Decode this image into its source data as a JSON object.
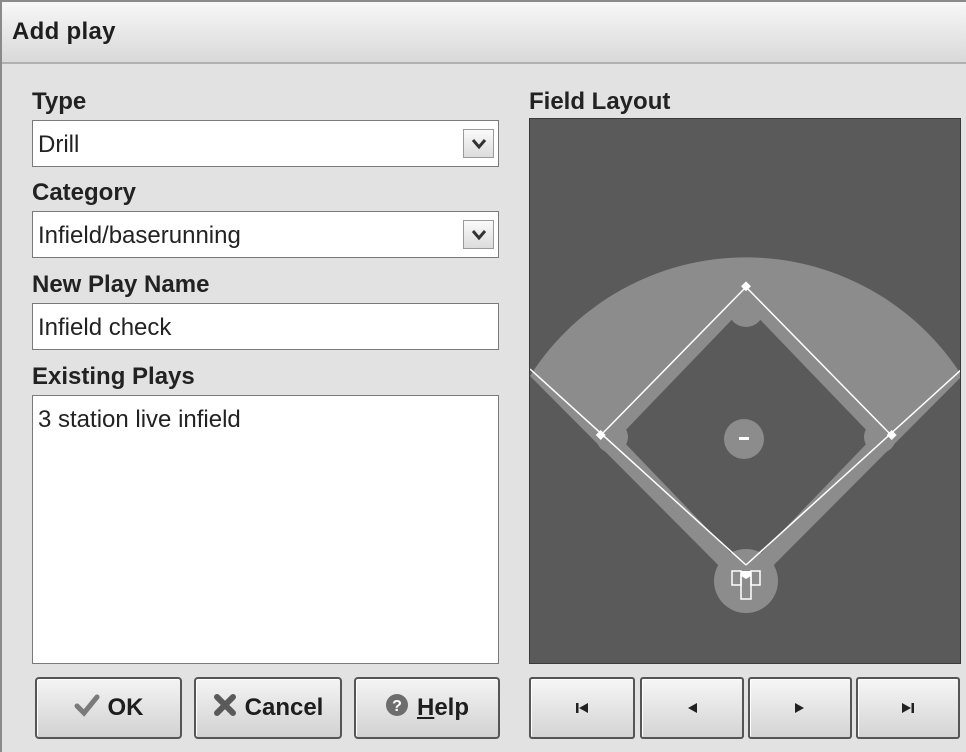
{
  "window": {
    "title": "Add play"
  },
  "type": {
    "label": "Type",
    "value": "Drill"
  },
  "category": {
    "label": "Category",
    "value": "Infield/baserunning"
  },
  "new_play_name": {
    "label": "New Play Name",
    "value": "Infield check"
  },
  "existing_plays": {
    "label": "Existing Plays",
    "items": [
      "3 station live infield"
    ]
  },
  "buttons": {
    "ok": "OK",
    "cancel": "Cancel",
    "help_prefix": "",
    "help_mnemonic": "H",
    "help_rest": "elp"
  },
  "field_layout": {
    "label": "Field Layout"
  },
  "nav": {
    "first": "first-icon",
    "prev": "previous-icon",
    "next": "next-icon",
    "last": "last-icon"
  },
  "colors": {
    "field_bg": "#5a5a5a",
    "outfield": "#8c8c8c",
    "infield": "#6b6b6b",
    "lines": "#ffffff"
  }
}
